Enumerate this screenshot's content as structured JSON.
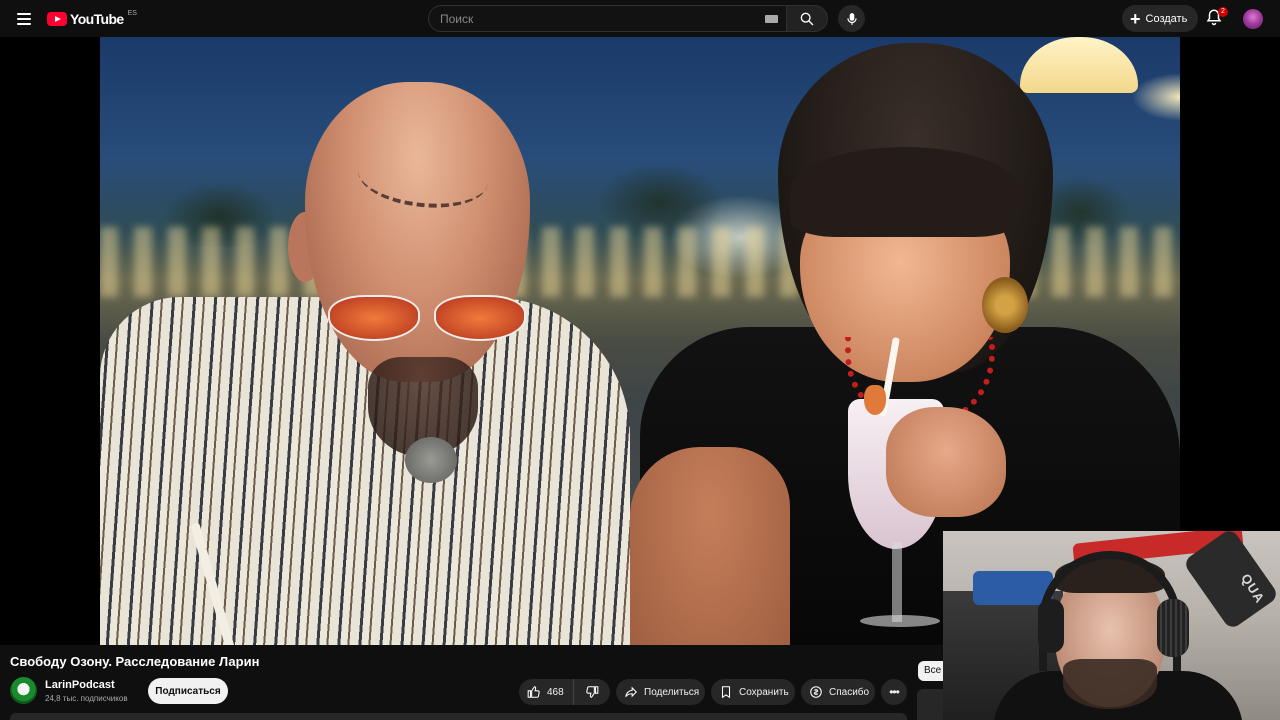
{
  "header": {
    "logo_text": "YouTube",
    "region": "ES",
    "search_placeholder": "Поиск",
    "create_label": "Создать",
    "notification_count": "2"
  },
  "video": {
    "title": "Свободу Озону. Расследование Ларин",
    "channel_name": "LarinPodcast",
    "subscribers": "24,8 тыс. подписчиков",
    "subscribe_label": "Подписаться",
    "likes": "468",
    "share_label": "Поделиться",
    "save_label": "Сохранить",
    "thanks_label": "Спасибо",
    "more_label": "•••"
  },
  "sidebar": {
    "chip_all": "Все"
  },
  "webcam": {
    "caption": "QUA"
  },
  "colors": {
    "brand_red": "#ff0033",
    "background": "#0f0f0f",
    "pill": "#272727"
  },
  "icons": [
    "menu-icon",
    "youtube-logo-icon",
    "keyboard-icon",
    "search-icon",
    "microphone-icon",
    "plus-icon",
    "bell-icon",
    "miniplayer-icon",
    "thumbs-up-icon",
    "thumbs-down-icon",
    "share-icon",
    "save-icon",
    "thanks-icon",
    "more-icon"
  ]
}
